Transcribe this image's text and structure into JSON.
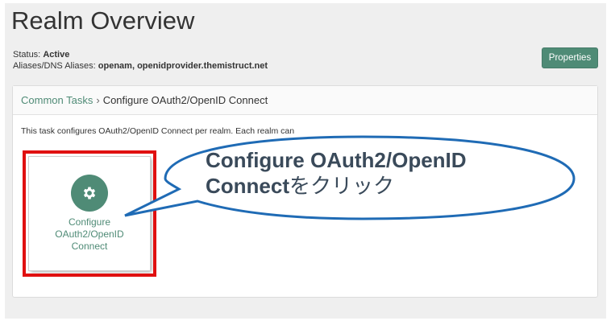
{
  "header": {
    "title": "Realm Overview",
    "status_label": "Status:",
    "status_value": "Active",
    "aliases_label": "Aliases/DNS Aliases:",
    "aliases_value": "openam, openidprovider.themistruct.net",
    "properties_button": "Properties"
  },
  "panel": {
    "breadcrumb_root": "Common Tasks",
    "breadcrumb_separator": "›",
    "breadcrumb_current": "Configure OAuth2/OpenID Connect",
    "description": "This task configures OAuth2/OpenID Connect per realm. Each realm can"
  },
  "tile": {
    "icon": "gear-icon",
    "label_line1": "Configure",
    "label_line2": "OAuth2/OpenID",
    "label_line3": "Connect"
  },
  "annotation": {
    "line1": "Configure OAuth2/OpenID",
    "line2_bold": "Connect",
    "line2_suffix": "をクリック",
    "highlight_color": "#e01010",
    "callout_border_color": "#1f6bb5"
  },
  "colors": {
    "accent": "#4f8b76"
  }
}
